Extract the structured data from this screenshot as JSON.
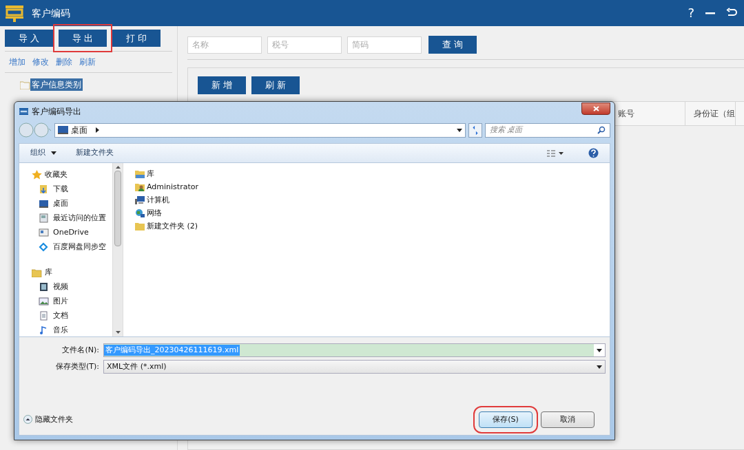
{
  "app": {
    "title": "客户编码",
    "help": "?"
  },
  "left_toolbar": [
    {
      "label": "导 入",
      "highlighted": false
    },
    {
      "label": "导 出",
      "highlighted": true
    },
    {
      "label": "打 印",
      "highlighted": false
    }
  ],
  "left_links": [
    "增加",
    "修改",
    "删除",
    "刷新"
  ],
  "tree": [
    {
      "label": "客户信息类别",
      "selected": true
    }
  ],
  "search": {
    "fields": [
      {
        "placeholder": "名称"
      },
      {
        "placeholder": "税号"
      },
      {
        "placeholder": "简码"
      }
    ],
    "button": "查 询"
  },
  "actions": [
    "新 增",
    "刷 新"
  ],
  "table": {
    "columns": [
      "账号",
      "身份证（组"
    ]
  },
  "dialog": {
    "title": "客户编码导出",
    "breadcrumb": "桌面",
    "search_placeholder": "搜索 桌面",
    "toolbar": [
      "组织",
      "新建文件夹"
    ],
    "nav": [
      {
        "label": "收藏夹",
        "children": [
          {
            "label": "下载"
          },
          {
            "label": "桌面"
          },
          {
            "label": "最近访问的位置"
          },
          {
            "label": "OneDrive"
          },
          {
            "label": "百度网盘同步空"
          }
        ]
      },
      {
        "label": "库",
        "children": [
          {
            "label": "视频"
          },
          {
            "label": "图片"
          },
          {
            "label": "文档"
          },
          {
            "label": "音乐"
          }
        ]
      }
    ],
    "files": [
      "库",
      "Administrator",
      "计算机",
      "网络",
      "新建文件夹 (2)"
    ],
    "filename_label": "文件名(N):",
    "filename": "客户编码导出_20230426111619.xml",
    "filetype_label": "保存类型(T):",
    "filetype": "XML文件 (*.xml)",
    "hide_folders": "隐藏文件夹",
    "buttons": [
      {
        "label": "保存(S)",
        "highlighted": true
      },
      {
        "label": "取消",
        "highlighted": false
      }
    ]
  }
}
